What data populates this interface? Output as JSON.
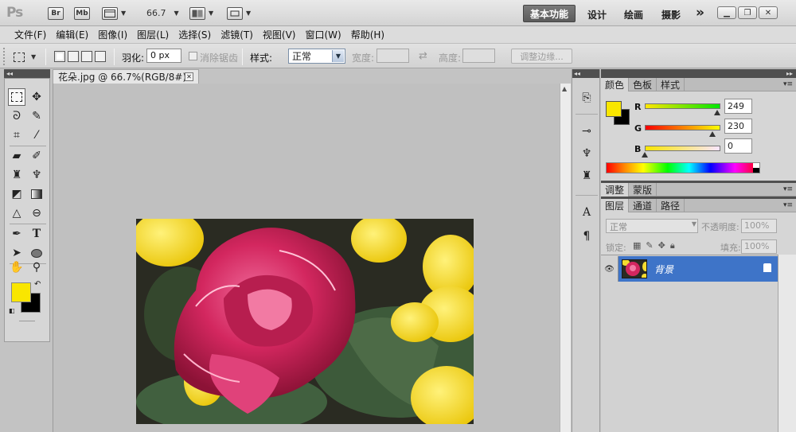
{
  "app": {
    "logo": "Ps",
    "bridge_label": "Br",
    "minibridge_label": "Mb",
    "zoom": "66.7",
    "workspaces": [
      "基本功能",
      "设计",
      "绘画",
      "摄影"
    ],
    "more": "»"
  },
  "menu": [
    "文件(F)",
    "编辑(E)",
    "图像(I)",
    "图层(L)",
    "选择(S)",
    "滤镜(T)",
    "视图(V)",
    "窗口(W)",
    "帮助(H)"
  ],
  "options": {
    "feather_label": "羽化:",
    "feather_value": "0 px",
    "antialias_label": "消除锯齿",
    "style_label": "样式:",
    "style_value": "正常",
    "width_label": "宽度:",
    "height_label": "高度:",
    "refine_edge": "调整边缘..."
  },
  "document": {
    "tab_title": "花朵.jpg @ 66.7%(RGB/8#)"
  },
  "color_panel": {
    "tabs": [
      "颜色",
      "色板",
      "样式"
    ],
    "r_label": "R",
    "r_value": "249",
    "g_label": "G",
    "g_value": "230",
    "b_label": "B",
    "b_value": "0",
    "foreground": "#f9e600",
    "background": "#000000"
  },
  "adjust_panel": {
    "tabs": [
      "调整",
      "蒙版"
    ]
  },
  "layers_panel": {
    "tabs": [
      "图层",
      "通道",
      "路径"
    ],
    "blend_mode": "正常",
    "opacity_label": "不透明度:",
    "opacity_value": "100%",
    "lock_label": "锁定:",
    "fill_label": "填充:",
    "fill_value": "100%",
    "layers": [
      {
        "name": "背景",
        "locked": true
      }
    ]
  },
  "colors": {
    "accent_selected_layer": "#3e74c8",
    "foreground_swatch": "#f9e600"
  }
}
